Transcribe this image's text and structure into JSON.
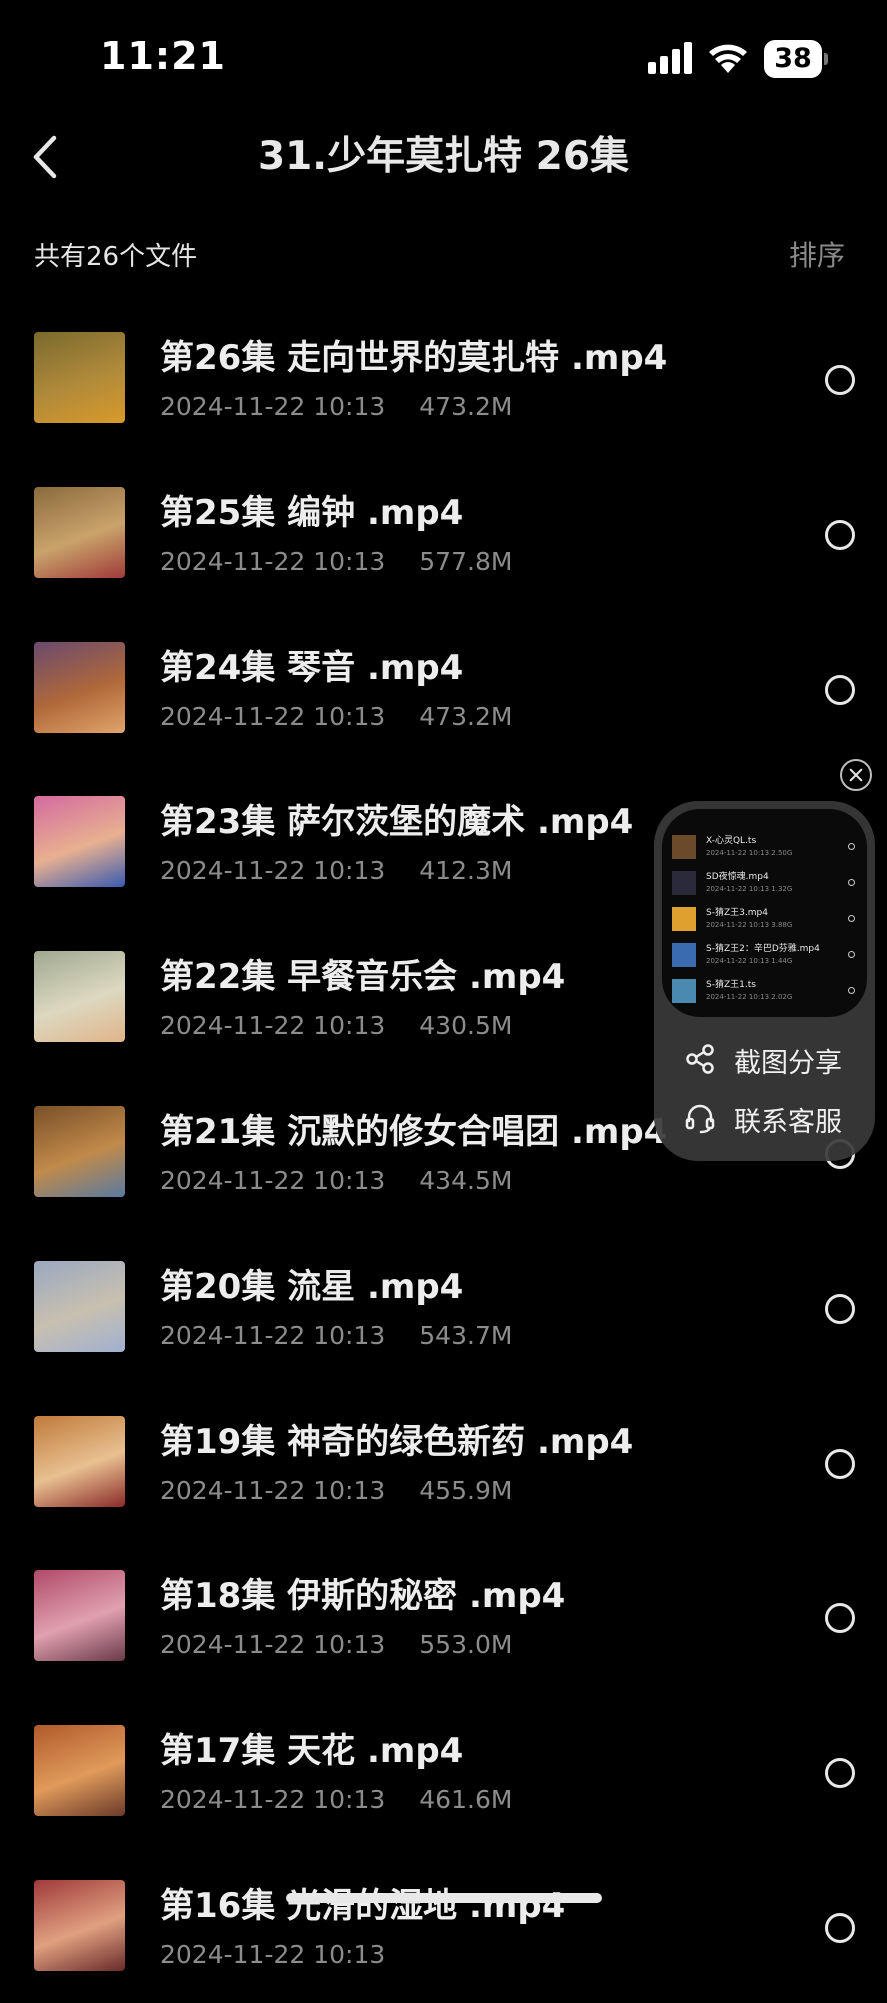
{
  "status_bar": {
    "time": "11:21",
    "battery": "38",
    "icons": [
      "cellular-signal-icon",
      "wifi-icon",
      "battery-icon"
    ]
  },
  "nav": {
    "back_icon": "chevron-left-icon",
    "title": "31.少年莫扎特 26集"
  },
  "summary": {
    "count_text": "共有26个文件",
    "sort_label": "排序"
  },
  "files": [
    {
      "name": "第26集 走向世界的莫扎特 .mp4",
      "date": "2024-11-22 10:13",
      "size": "473.2M",
      "thumb_colors": [
        "#7a6a2e",
        "#b08a3a",
        "#d99a2a"
      ]
    },
    {
      "name": "第25集 编钟 .mp4",
      "date": "2024-11-22 10:13",
      "size": "577.8M",
      "thumb_colors": [
        "#8a6a3e",
        "#c9a36a",
        "#a03a3a"
      ]
    },
    {
      "name": "第24集 琴音 .mp4",
      "date": "2024-11-22 10:13",
      "size": "473.2M",
      "thumb_colors": [
        "#6a4a6e",
        "#b0683a",
        "#e0a46a"
      ]
    },
    {
      "name": "第23集 萨尔茨堡的魔术 .mp4",
      "date": "2024-11-22 10:13",
      "size": "412.3M",
      "thumb_colors": [
        "#d46aa0",
        "#e8b090",
        "#3a5ab0"
      ]
    },
    {
      "name": "第22集 早餐音乐会 .mp4",
      "date": "2024-11-22 10:13",
      "size": "430.5M",
      "thumb_colors": [
        "#a0a890",
        "#dcd8c0",
        "#e0b48a"
      ]
    },
    {
      "name": "第21集 沉默的修女合唱团 .mp4",
      "date": "2024-11-22 10:13",
      "size": "434.5M",
      "thumb_colors": [
        "#7a5028",
        "#c08a4a",
        "#5a7aa0"
      ]
    },
    {
      "name": "第20集 流星 .mp4",
      "date": "2024-11-22 10:13",
      "size": "543.7M",
      "thumb_colors": [
        "#9aa8c0",
        "#c8c0b0",
        "#a0b0d0"
      ]
    },
    {
      "name": "第19集 神奇的绿色新药 .mp4",
      "date": "2024-11-22 10:13",
      "size": "455.9M",
      "thumb_colors": [
        "#c07a3a",
        "#e8c090",
        "#8a2a2a"
      ]
    },
    {
      "name": "第18集 伊斯的秘密 .mp4",
      "date": "2024-11-22 10:13",
      "size": "553.0M",
      "thumb_colors": [
        "#b04a6a",
        "#e0a0b0",
        "#6a3a4a"
      ]
    },
    {
      "name": "第17集 天花 .mp4",
      "date": "2024-11-22 10:13",
      "size": "461.6M",
      "thumb_colors": [
        "#b05a2a",
        "#e09a5a",
        "#6a3a2a"
      ]
    },
    {
      "name": "第16集 光滑的湿地 .mp4",
      "date": "2024-11-22 10:13",
      "size": "",
      "thumb_colors": [
        "#a03a3a",
        "#e0a080",
        "#6a2a2a"
      ]
    }
  ],
  "floating_widget": {
    "close_icon": "close-icon",
    "preview_rows": [
      {
        "name": "X-心灵QL.ts",
        "meta": "2024-11-22 10:13   2.50G",
        "color": "#6a4a2a"
      },
      {
        "name": "SD夜惊魂.mp4",
        "meta": "2024-11-22 10:13   1.32G",
        "color": "#2a2a3a"
      },
      {
        "name": "S-猜Z王3.mp4",
        "meta": "2024-11-22 10:13   3.88G",
        "color": "#e0a030"
      },
      {
        "name": "S-猜Z王2：辛巴D芬雅.mp4",
        "meta": "2024-11-22 10:13   1.44G",
        "color": "#3a6ab0"
      },
      {
        "name": "S-猜Z王1.ts",
        "meta": "2024-11-22 10:13   2.02G",
        "color": "#4a8ab0"
      }
    ],
    "share_label": "截图分享",
    "share_icon": "share-icon",
    "support_label": "联系客服",
    "support_icon": "headset-icon"
  }
}
